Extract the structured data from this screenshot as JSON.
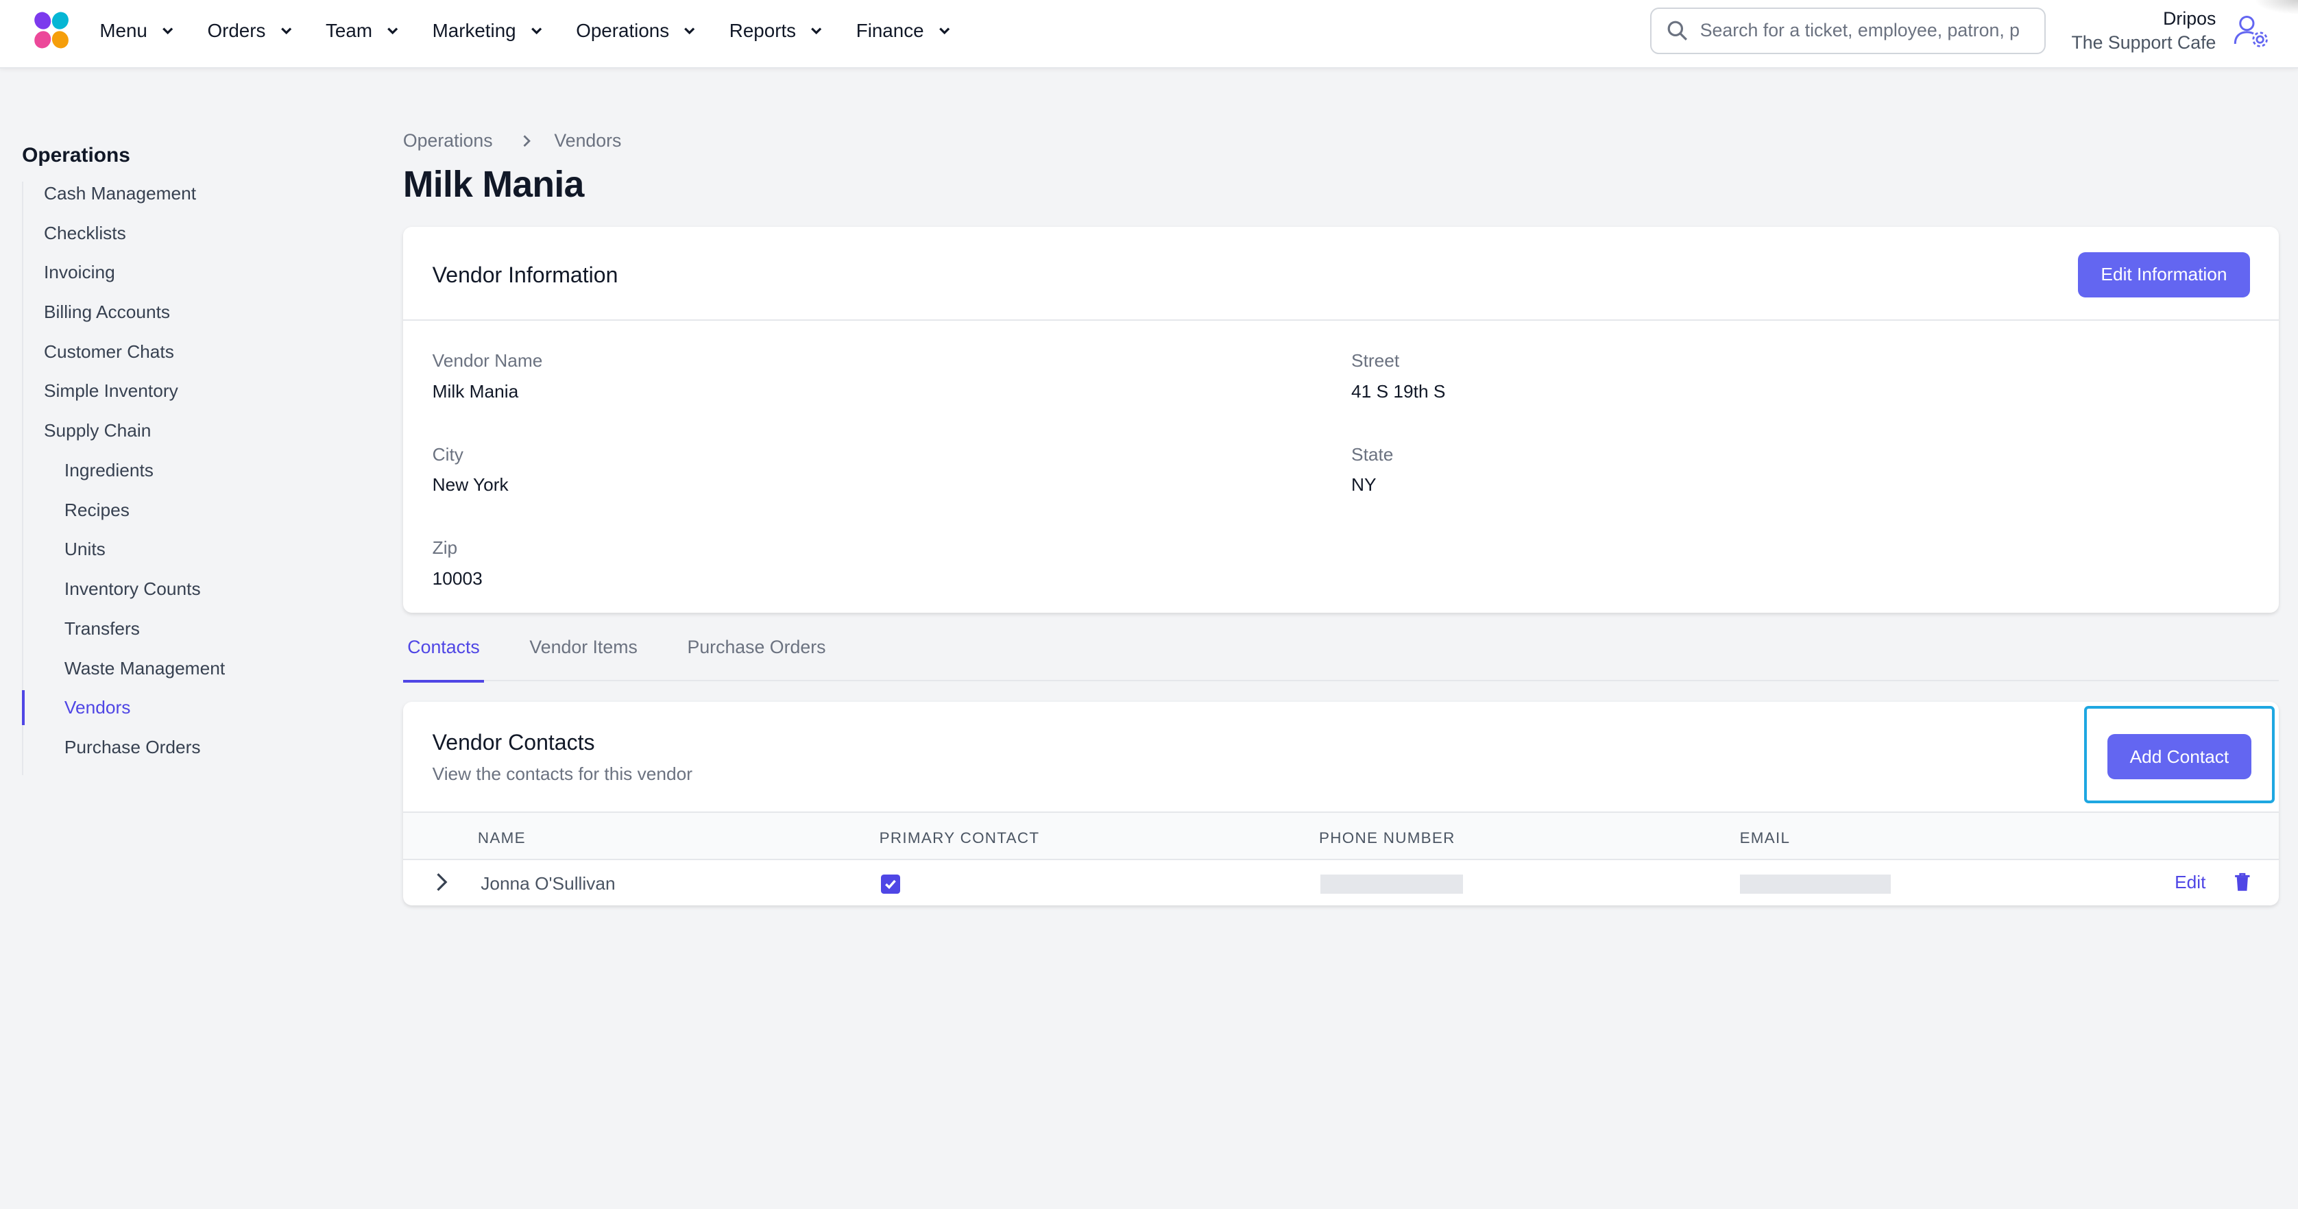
{
  "colors": {
    "accent": "#6366f1",
    "accent_text": "#4f46e5",
    "highlight": "#1ea7e1",
    "background": "#f3f4f6"
  },
  "topbar": {
    "logo_icon": "dripos-logo-icon",
    "nav": [
      {
        "label": "Menu"
      },
      {
        "label": "Orders"
      },
      {
        "label": "Team"
      },
      {
        "label": "Marketing"
      },
      {
        "label": "Operations"
      },
      {
        "label": "Reports"
      },
      {
        "label": "Finance"
      }
    ],
    "search": {
      "placeholder": "Search for a ticket, employee, patron, p",
      "icon": "search-icon"
    },
    "account": {
      "name": "Dripos",
      "org": "The Support Cafe",
      "icon": "user-settings-icon"
    }
  },
  "sidebar": {
    "heading": "Operations",
    "items": [
      {
        "label": "Cash Management"
      },
      {
        "label": "Checklists"
      },
      {
        "label": "Invoicing"
      },
      {
        "label": "Billing Accounts"
      },
      {
        "label": "Customer Chats"
      },
      {
        "label": "Simple Inventory"
      },
      {
        "label": "Supply Chain"
      },
      {
        "label": "Ingredients"
      },
      {
        "label": "Recipes"
      },
      {
        "label": "Units"
      },
      {
        "label": "Inventory Counts"
      },
      {
        "label": "Transfers"
      },
      {
        "label": "Waste Management"
      },
      {
        "label": "Vendors"
      },
      {
        "label": "Purchase Orders"
      }
    ]
  },
  "breadcrumb": {
    "parent": "Operations",
    "current": "Vendors"
  },
  "page_title": "Milk Mania",
  "vendor_info": {
    "title": "Vendor Information",
    "edit_button": "Edit Information",
    "fields": {
      "vendor_name": {
        "label": "Vendor Name",
        "value": "Milk Mania"
      },
      "street": {
        "label": "Street",
        "value": "41 S 19th S"
      },
      "city": {
        "label": "City",
        "value": "New York"
      },
      "state": {
        "label": "State",
        "value": "NY"
      },
      "zip": {
        "label": "Zip",
        "value": "10003"
      }
    }
  },
  "tabs": [
    {
      "label": "Contacts",
      "active": true
    },
    {
      "label": "Vendor Items",
      "active": false
    },
    {
      "label": "Purchase Orders",
      "active": false
    }
  ],
  "contacts": {
    "title": "Vendor Contacts",
    "subtitle": "View the contacts for this vendor",
    "add_button": "Add Contact",
    "columns": [
      "Name",
      "Primary Contact",
      "Phone Number",
      "Email"
    ],
    "rows": [
      {
        "name": "Jonna O'Sullivan",
        "primary": true,
        "edit_label": "Edit"
      }
    ]
  }
}
